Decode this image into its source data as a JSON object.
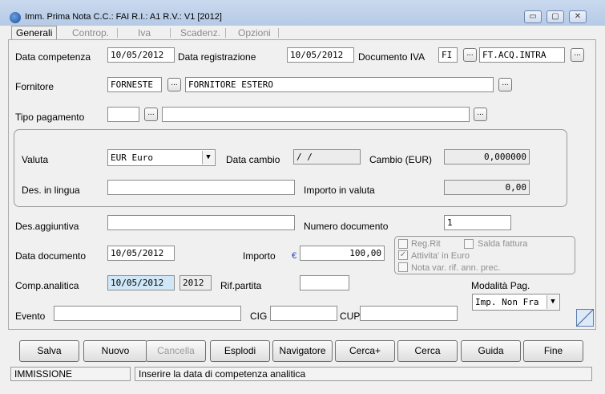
{
  "window": {
    "title": "Imm. Prima Nota C.C.: FAI  R.I.: A1  R.V.: V1  [2012]",
    "minimize": "▭",
    "maximize": "▢",
    "close": "✕"
  },
  "tabs": [
    {
      "label": "Generali",
      "active": true
    },
    {
      "label": "Controp.",
      "active": false
    },
    {
      "label": "Iva",
      "active": false
    },
    {
      "label": "Scadenz.",
      "active": false
    },
    {
      "label": "Opzioni",
      "active": false
    }
  ],
  "form": {
    "data_competenza_label": "Data competenza",
    "data_competenza": "10/05/2012",
    "data_registrazione_label": "Data registrazione",
    "data_registrazione": "10/05/2012",
    "documento_iva_label": "Documento IVA",
    "documento_iva_code": "FI",
    "documento_iva_desc": "FT.ACQ.INTRA",
    "fornitore_label": "Fornitore",
    "fornitore_code": "FORNESTE",
    "fornitore_desc": "FORNITORE ESTERO",
    "tipo_pagamento_label": "Tipo pagamento",
    "tipo_pagamento_code": "",
    "tipo_pagamento_desc": "",
    "valuta_label": "Valuta",
    "valuta": "EUR Euro",
    "data_cambio_label": "Data cambio",
    "data_cambio": " /  /",
    "cambio_label": "Cambio  (EUR)",
    "cambio": "0,000000",
    "des_lingua_label": "Des. in lingua",
    "des_lingua": "",
    "importo_valuta_label": "Importo in valuta",
    "importo_valuta": "0,00",
    "des_aggiuntiva_label": "Des.aggiuntiva",
    "des_aggiuntiva": "",
    "numero_documento_label": "Numero documento",
    "numero_documento": "1",
    "data_documento_label": "Data documento",
    "data_documento": "10/05/2012",
    "importo_label": "Importo",
    "currency_symbol": "€",
    "importo": "100,00",
    "comp_analitica_label": "Comp.analitica",
    "comp_analitica": "10/05/2012",
    "comp_analitica_year": "2012",
    "rif_partita_label": "Rif.partita",
    "rif_partita": "",
    "modalita_pag_label": "Modalità Pag.",
    "modalita_pag": "Imp. Non Fra",
    "evento_label": "Evento",
    "evento": "",
    "cig_label": "CIG",
    "cig": "",
    "cup_label": "CUP",
    "cup": "",
    "checkboxes": {
      "reg_rit": "Reg.Rit",
      "saldo_fattura": "Salda fattura",
      "attivita_euro": "Attivita' in Euro",
      "nota_var": "Nota var. rif. ann. prec."
    },
    "ellipsis": "..."
  },
  "buttons": {
    "salva": "Salva",
    "nuovo": "Nuovo",
    "cancella": "Cancella",
    "esplodi": "Esplodi",
    "navigatore": "Navigatore",
    "cerca_plus": "Cerca+",
    "cerca": "Cerca",
    "guida": "Guida",
    "fine": "Fine"
  },
  "status": {
    "mode": "IMMISSIONE",
    "message": "Inserire la data di competenza analitica"
  }
}
